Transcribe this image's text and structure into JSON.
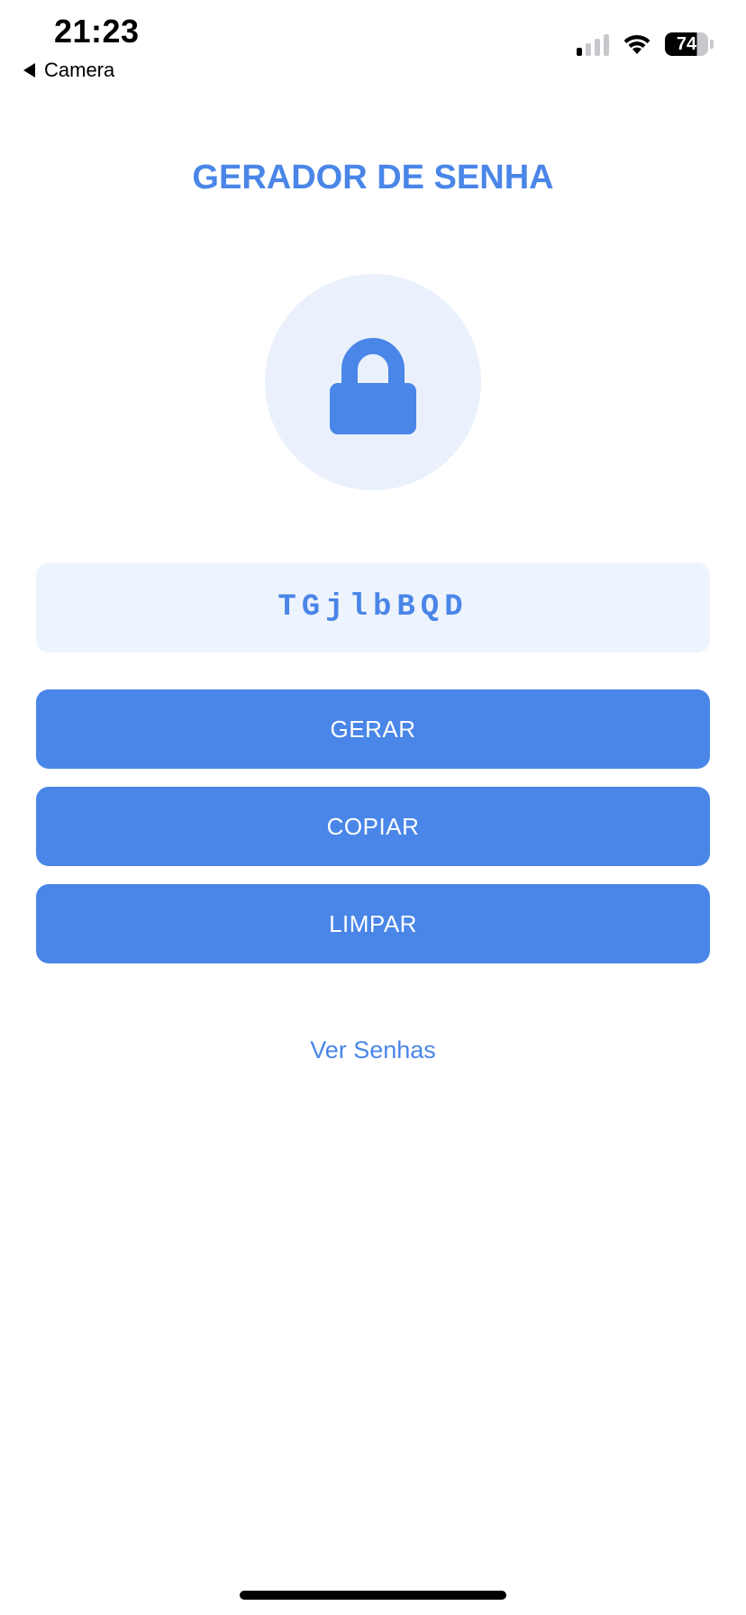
{
  "status_bar": {
    "time": "21:23",
    "back_app_label": "Camera",
    "battery_level": "74",
    "icons": [
      "cellular-signal-icon",
      "wifi-icon",
      "battery-icon"
    ]
  },
  "header": {
    "title": "GERADOR DE SENHA"
  },
  "lock": {
    "icon": "lock-icon"
  },
  "password": {
    "value": "TGjlbBQD"
  },
  "actions": {
    "generate_label": "GERAR",
    "copy_label": "COPIAR",
    "clear_label": "LIMPAR"
  },
  "links": {
    "view_passwords_label": "Ver Senhas"
  },
  "colors": {
    "accent": "#4a86e8",
    "lock_circle_bg": "#eaf1fc",
    "password_box_bg": "#eef4fd"
  }
}
